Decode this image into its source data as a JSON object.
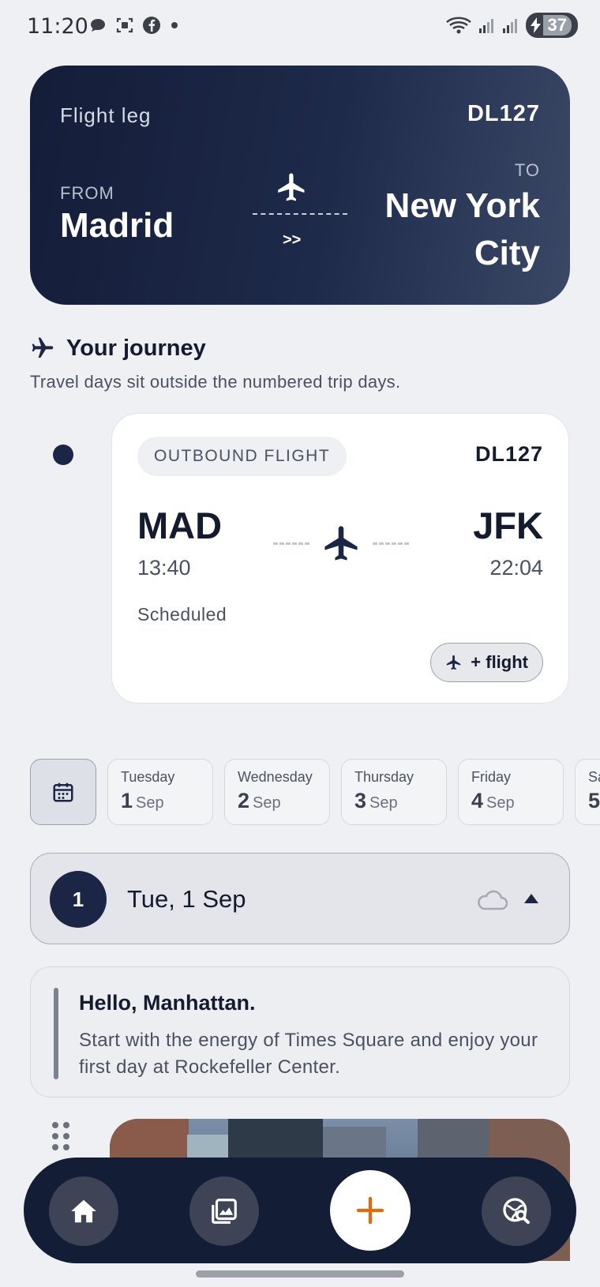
{
  "status_bar": {
    "time": "11:20",
    "battery": "37"
  },
  "hero": {
    "leg_label": "Flight leg",
    "flight_code": "DL127",
    "from_label": "FROM",
    "from_city": "Madrid",
    "arrows": ">>",
    "to_label": "TO",
    "to_city": "New York City"
  },
  "journey": {
    "title": "Your journey",
    "subtitle": "Travel days sit outside the numbered trip days."
  },
  "flight_card": {
    "type_label": "OUTBOUND FLIGHT",
    "flight_code": "DL127",
    "departure_code": "MAD",
    "departure_time": "13:40",
    "arrival_code": "JFK",
    "arrival_time": "22:04",
    "status": "Scheduled",
    "add_flight_label": "+ flight"
  },
  "days": [
    {
      "name": "Tuesday",
      "num": "1",
      "month": "Sep"
    },
    {
      "name": "Wednesday",
      "num": "2",
      "month": "Sep"
    },
    {
      "name": "Thursday",
      "num": "3",
      "month": "Sep"
    },
    {
      "name": "Friday",
      "num": "4",
      "month": "Sep"
    },
    {
      "name": "Sa",
      "num": "5",
      "month": ""
    }
  ],
  "day_header": {
    "badge": "1",
    "title": "Tue, 1 Sep"
  },
  "note": {
    "title": "Hello, Manhattan.",
    "body": "Start with the energy of Times Square and enjoy your first day at Rockefeller Center."
  },
  "nav": {
    "items": [
      "home-icon",
      "gallery-icon",
      "add-icon",
      "search-map-icon"
    ],
    "accent": "#e06a12"
  }
}
